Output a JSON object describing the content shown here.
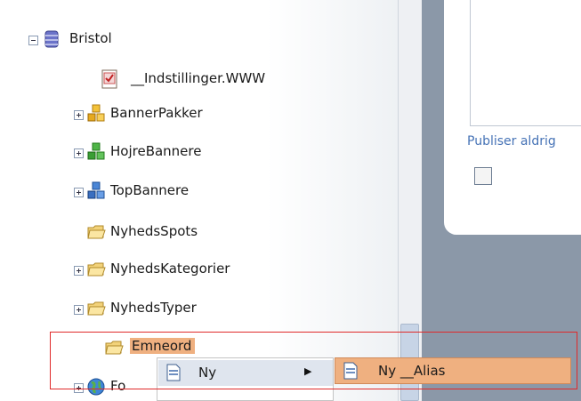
{
  "tree": {
    "items": [
      {
        "label": "Bristol",
        "expander": "minus",
        "icon": "database-icon"
      },
      {
        "label": "__Indstillinger.WWW",
        "expander": "none",
        "icon": "settings-document-icon"
      },
      {
        "label": "BannerPakker",
        "expander": "plus",
        "icon": "yellow-cubes-icon"
      },
      {
        "label": "HojreBannere",
        "expander": "plus",
        "icon": "green-cubes-icon"
      },
      {
        "label": "TopBannere",
        "expander": "plus",
        "icon": "blue-cubes-icon"
      },
      {
        "label": "NyhedsSpots",
        "expander": "none",
        "icon": "folder-icon"
      },
      {
        "label": "NyhedsKategorier",
        "expander": "plus",
        "icon": "folder-icon"
      },
      {
        "label": "NyhedsTyper",
        "expander": "plus",
        "icon": "folder-icon"
      },
      {
        "label": "Emneord",
        "expander": "none",
        "icon": "folder-icon",
        "selected": true
      },
      {
        "label": "Fo",
        "expander": "plus",
        "icon": "globe-icon"
      }
    ]
  },
  "context_menu": {
    "item": {
      "label": "Ny",
      "icon": "document-icon",
      "has_submenu": true
    },
    "submenu": {
      "item": {
        "label": "Ny __Alias",
        "icon": "document-icon"
      }
    }
  },
  "right_panel": {
    "publish_label": "Publiser aldrig"
  },
  "colors": {
    "selection_outline": "#e02a2a",
    "submenu_highlight": "#efb080",
    "link_blue": "#4673b6",
    "background_gray": "#8b98a8"
  }
}
